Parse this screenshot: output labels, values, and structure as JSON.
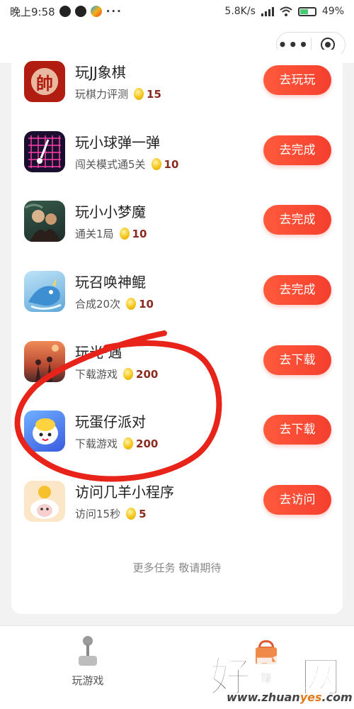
{
  "status_bar": {
    "time": "晚上9:58",
    "more": "···",
    "speed": "5.8K/s",
    "battery": "49%",
    "icons": [
      "qq-icon",
      "qq-icon",
      "weibo-icon",
      "signal-icon",
      "wifi-icon",
      "battery-icon"
    ]
  },
  "header": {
    "menu_glyph": "•••",
    "icons": [
      "more-icon",
      "close-miniapp-icon"
    ]
  },
  "tasks": [
    {
      "name": "玩JJ象棋",
      "desc": "玩棋力评测",
      "reward": "15",
      "button": "去玩玩",
      "icon_char": "帥"
    },
    {
      "name": "玩小球弹一弹",
      "desc": "闯关模式通5关",
      "reward": "10",
      "button": "去完成"
    },
    {
      "name": "玩小小梦魔",
      "desc": "通关1局",
      "reward": "10",
      "button": "去完成"
    },
    {
      "name": "玩召唤神鲲",
      "desc": "合成20次",
      "reward": "10",
      "button": "去完成"
    },
    {
      "name": "玩光·遇",
      "desc": "下载游戏",
      "reward": "200",
      "button": "去下载"
    },
    {
      "name": "玩蛋仔派对",
      "desc": "下载游戏",
      "reward": "200",
      "button": "去下载"
    },
    {
      "name": "访问几羊小程序",
      "desc": "访问15秒",
      "reward": "5",
      "button": "去访问"
    }
  ],
  "footer_note": "更多任务 敬请期待",
  "tabbar": {
    "games_label": "玩游戏",
    "earn_label": "赚",
    "icons": [
      "joystick-icon",
      "gift-icon"
    ]
  },
  "watermark": {
    "big": "好赚网",
    "url_pre": "www.zhuan",
    "url_mid": "yes",
    "url_post": ".com"
  },
  "colors": {
    "accent": "#f43f2e",
    "reward_text": "#8a2b22",
    "annotation": "#e8231a"
  }
}
